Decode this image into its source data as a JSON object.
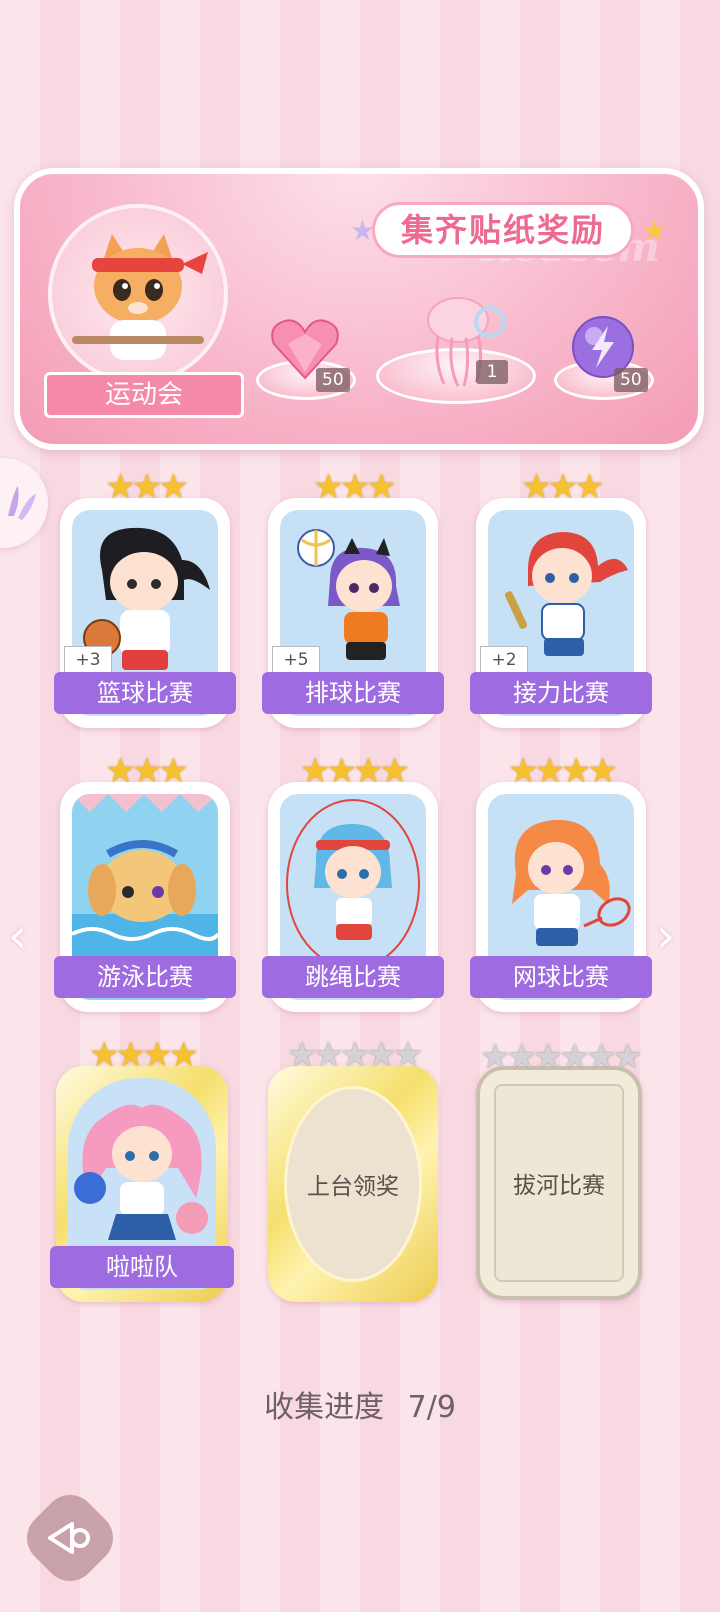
{
  "banner": {
    "title": "集齐贴纸奖励",
    "watermark": "Redeem",
    "event_name": "运动会",
    "rewards": [
      {
        "icon": "pink-heart-gem-icon",
        "count": "50"
      },
      {
        "icon": "jellyfish-decoration-icon",
        "count": "1"
      },
      {
        "icon": "purple-lightning-orb-icon",
        "count": "50"
      }
    ]
  },
  "cards": [
    {
      "label": "篮球比赛",
      "bonus": "+3",
      "stars_filled": 3,
      "stars_total": 3,
      "state": "collected"
    },
    {
      "label": "排球比赛",
      "bonus": "+5",
      "stars_filled": 3,
      "stars_total": 3,
      "state": "collected"
    },
    {
      "label": "接力比赛",
      "bonus": "+2",
      "stars_filled": 3,
      "stars_total": 3,
      "state": "collected"
    },
    {
      "label": "游泳比赛",
      "bonus": "",
      "stars_filled": 3,
      "stars_total": 3,
      "state": "collected"
    },
    {
      "label": "跳绳比赛",
      "bonus": "",
      "stars_filled": 4,
      "stars_total": 4,
      "state": "collected"
    },
    {
      "label": "网球比赛",
      "bonus": "",
      "stars_filled": 4,
      "stars_total": 4,
      "state": "collected"
    },
    {
      "label": "啦啦队",
      "bonus": "",
      "stars_filled": 4,
      "stars_total": 4,
      "state": "collected-gold"
    },
    {
      "label": "上台领奖",
      "bonus": "",
      "stars_filled": 0,
      "stars_total": 5,
      "state": "locked-gold"
    },
    {
      "label": "拔河比赛",
      "bonus": "",
      "stars_filled": 0,
      "stars_total": 6,
      "state": "locked-frame"
    }
  ],
  "progress": {
    "label": "收集进度",
    "value": "7/9"
  },
  "colors": {
    "accent": "#9f6be0",
    "banner_pink": "#f48aa8",
    "star_gold": "#f6c12f"
  }
}
